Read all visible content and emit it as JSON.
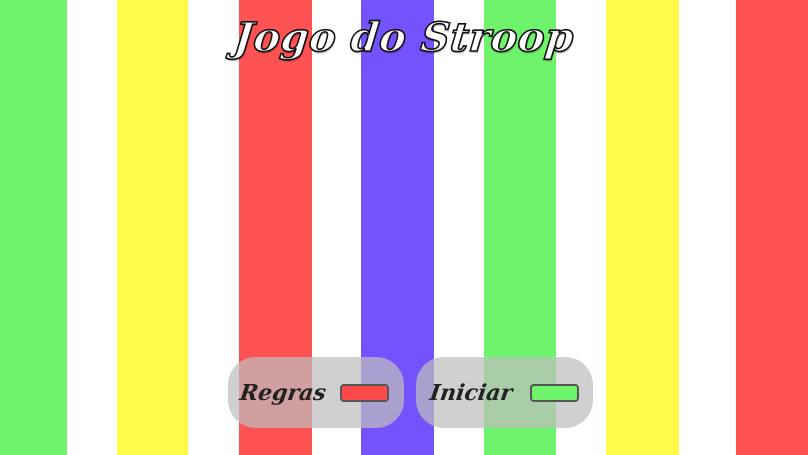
{
  "title": "Jogo do Stroop",
  "background": {
    "stripes": [
      {
        "color": "#6ff36c"
      },
      {
        "color": "#ffffff"
      },
      {
        "color": "#fdfb48"
      },
      {
        "color": "#ffffff"
      },
      {
        "color": "#ff5252"
      },
      {
        "color": "#ffffff"
      },
      {
        "color": "#7453fe"
      },
      {
        "color": "#ffffff"
      },
      {
        "color": "#6ff36c"
      },
      {
        "color": "#ffffff"
      },
      {
        "color": "#fdfb48"
      },
      {
        "color": "#ffffff"
      },
      {
        "color": "#ff5252"
      }
    ]
  },
  "buttons": {
    "rules": {
      "label": "Regras",
      "swatch_color": "#ff4a4a"
    },
    "start": {
      "label": "Iniciar",
      "swatch_color": "#6ff36c"
    }
  }
}
